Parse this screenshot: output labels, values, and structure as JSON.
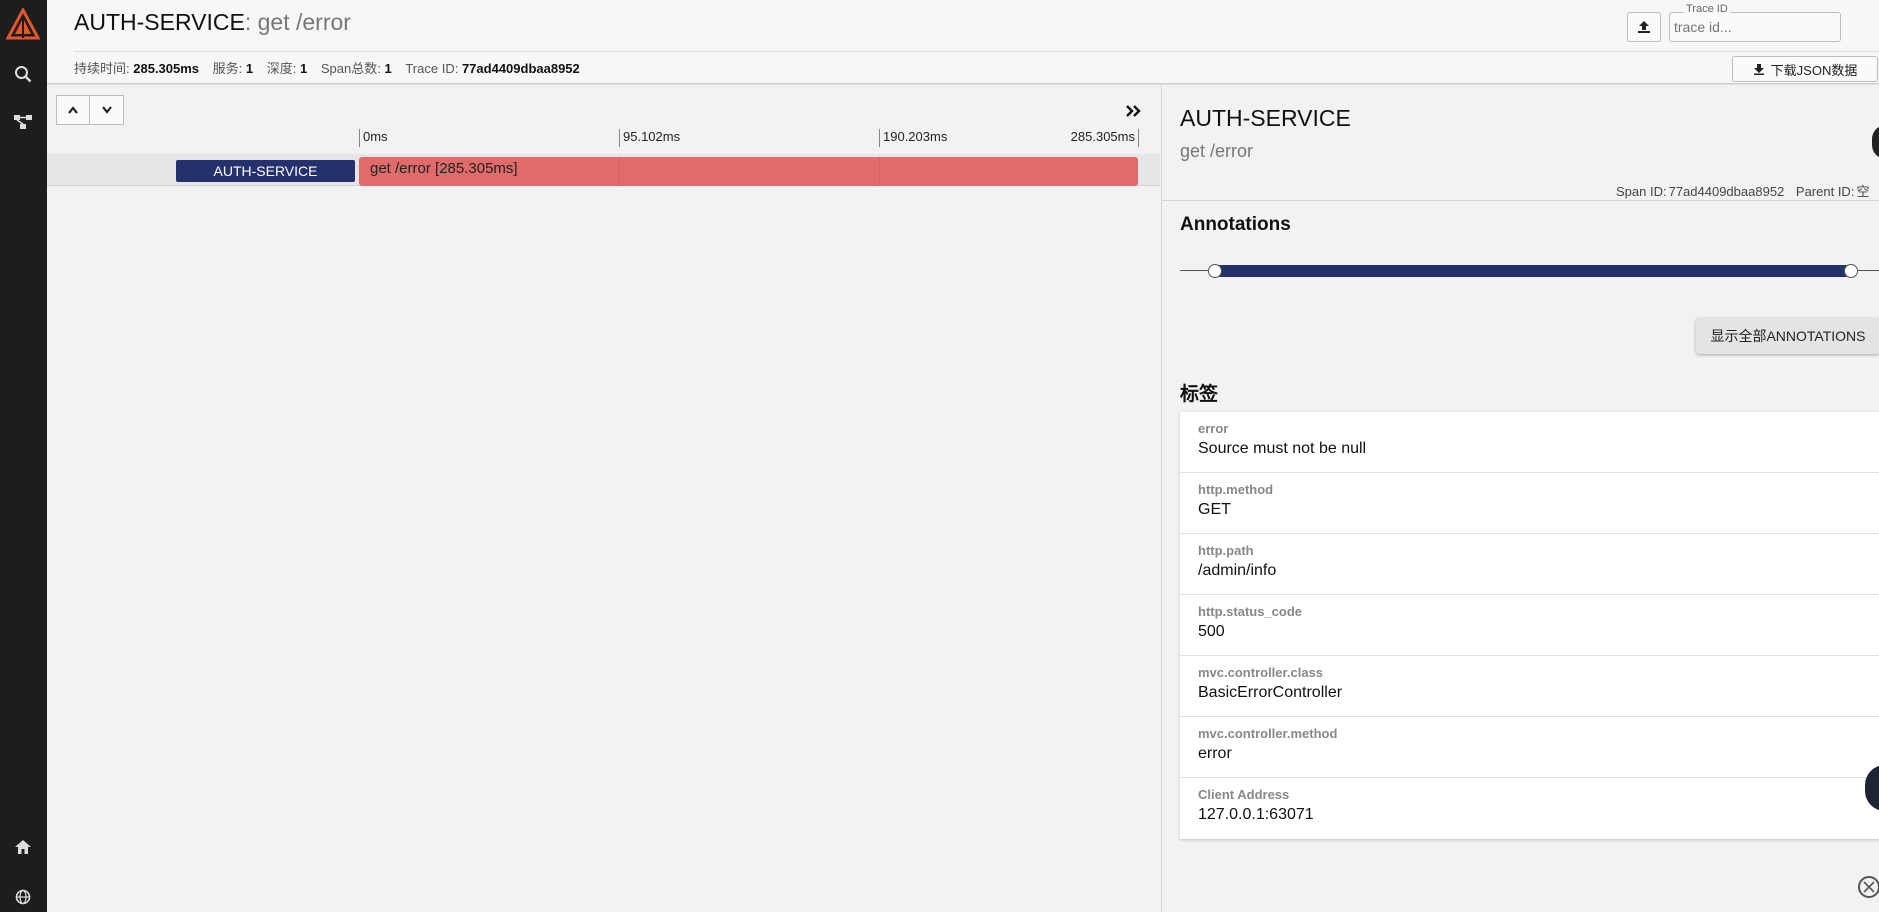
{
  "sidebar": {
    "items": [
      {
        "icon": "logo-icon"
      },
      {
        "icon": "search-icon"
      },
      {
        "icon": "dependencies-icon"
      },
      {
        "icon": "home-icon"
      },
      {
        "icon": "globe-icon"
      }
    ]
  },
  "header": {
    "service_name": "AUTH-SERVICE",
    "separator": ":",
    "operation": " get /error",
    "meta": [
      {
        "label": "持续时间:",
        "value": "285.305ms"
      },
      {
        "label": "服务:",
        "value": "1"
      },
      {
        "label": "深度:",
        "value": "1"
      },
      {
        "label": "Span总数:",
        "value": "1"
      },
      {
        "label": "Trace ID:",
        "value": "77ad4409dbaa8952"
      }
    ],
    "trace_id_label": "Trace ID",
    "trace_id_placeholder": "trace id...",
    "download_label": "下载JSON数据"
  },
  "timeline": {
    "ticks": [
      "0ms",
      "95.102ms",
      "190.203ms",
      "285.305ms"
    ],
    "span": {
      "service": "AUTH-SERVICE",
      "label": "get /error [285.305ms]",
      "color": "#e06b6b"
    }
  },
  "detail": {
    "service": "AUTH-SERVICE",
    "operation": "get /error",
    "span_id_label": "Span ID:",
    "span_id": "77ad4409dbaa8952",
    "parent_id_label": "Parent ID:",
    "parent_id": "空",
    "annotations_title": "Annotations",
    "show_all_annotations": "显示全部ANNOTATIONS",
    "tags_title": "标签",
    "tags": [
      {
        "key": "error",
        "value": "Source must not be null"
      },
      {
        "key": "http.method",
        "value": "GET"
      },
      {
        "key": "http.path",
        "value": "/admin/info"
      },
      {
        "key": "http.status_code",
        "value": "500"
      },
      {
        "key": "mvc.controller.class",
        "value": "BasicErrorController"
      },
      {
        "key": "mvc.controller.method",
        "value": "error"
      },
      {
        "key": "Client Address",
        "value": "127.0.0.1:63071"
      }
    ]
  },
  "colors": {
    "accent": "#25316d",
    "error_span": "#e06b6b",
    "logo": "#e4572e",
    "sidebar": "#1d1d1d"
  }
}
